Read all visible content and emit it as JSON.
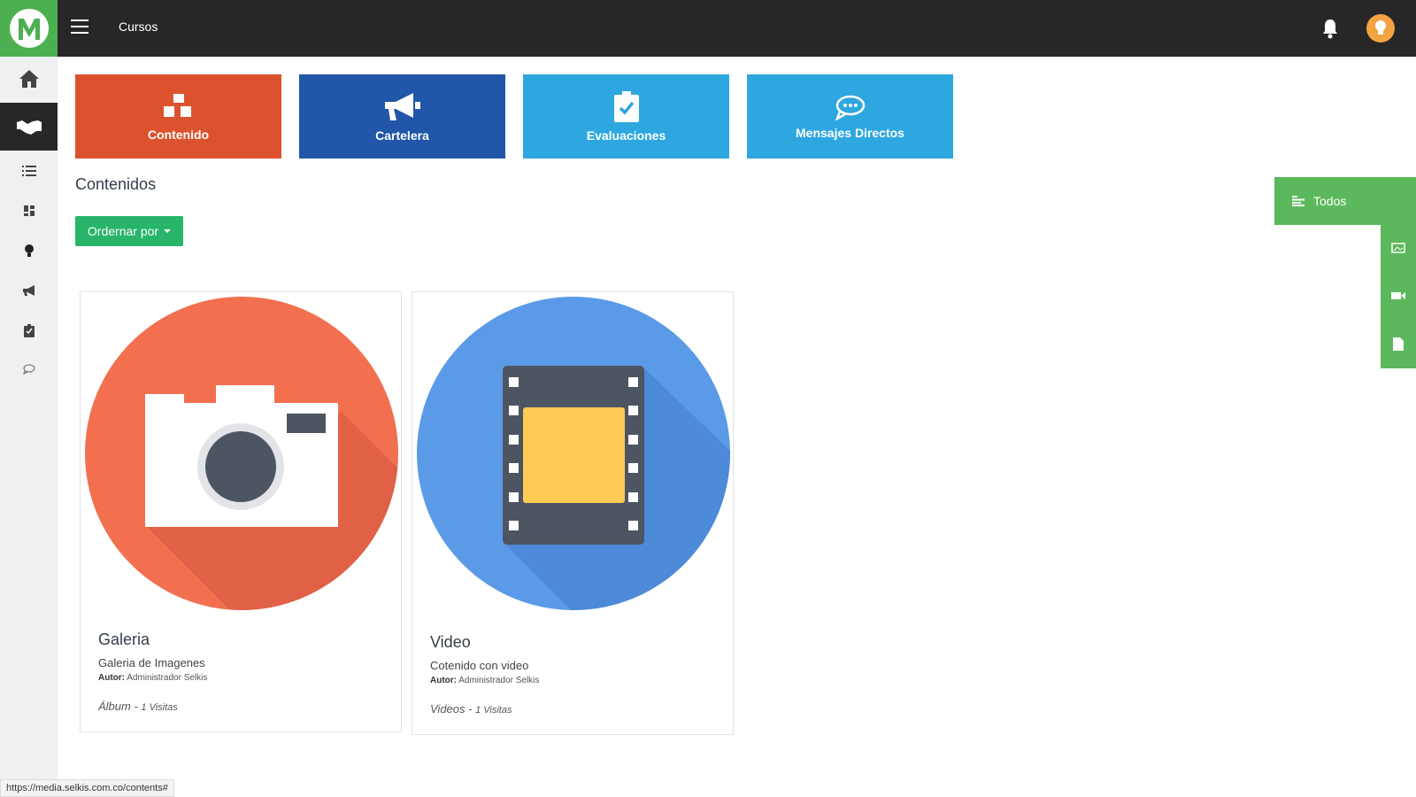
{
  "header": {
    "title": "Cursos",
    "menu_icon": "hamburger-icon",
    "notification_icon": "bell-icon",
    "avatar_icon": "lightbulb-avatar"
  },
  "sidebar": {
    "items": [
      {
        "name": "home",
        "icon": "home-icon"
      },
      {
        "name": "courses",
        "icon": "handshake-icon",
        "active": true
      },
      {
        "name": "list",
        "icon": "list-icon"
      },
      {
        "name": "dashboard",
        "icon": "grid-icon"
      },
      {
        "name": "ideas",
        "icon": "lightbulb-icon"
      },
      {
        "name": "announcements",
        "icon": "megaphone-icon"
      },
      {
        "name": "evaluations",
        "icon": "clipboard-check-icon"
      },
      {
        "name": "messages",
        "icon": "chat-icon"
      }
    ]
  },
  "tiles": [
    {
      "label": "Contenido",
      "color": "#dd522e",
      "icon": "cubes-icon"
    },
    {
      "label": "Cartelera",
      "color": "#2156a8",
      "icon": "megaphone-icon"
    },
    {
      "label": "Evaluaciones",
      "color": "#2ea7e0",
      "icon": "clipboard-check-icon"
    },
    {
      "label": "Mensajes Directos",
      "color": "#2ea7e0",
      "icon": "chat-icon"
    }
  ],
  "content": {
    "section_title": "Contenidos",
    "sort_button": "Ordernar por"
  },
  "cards": [
    {
      "title": "Galeria",
      "description": "Galeria de Imagenes",
      "author_label": "Autor:",
      "author": "Administrador Selkis",
      "type": "Álbum -",
      "visits": "1 Visitas",
      "icon": "camera-icon",
      "circle_color": "#f2704f"
    },
    {
      "title": "Video",
      "description": "Cotenido con video",
      "author_label": "Autor:",
      "author": "Administrador Selkis",
      "type": "Videos -",
      "visits": "1 Visitas",
      "icon": "film-icon",
      "circle_color": "#5b9ae6"
    }
  ],
  "filter": {
    "label": "Todos",
    "icons": [
      "image-icon",
      "video-icon",
      "document-icon"
    ]
  },
  "status_bar": {
    "url": "https://media.selkis.com.co/contents#"
  }
}
